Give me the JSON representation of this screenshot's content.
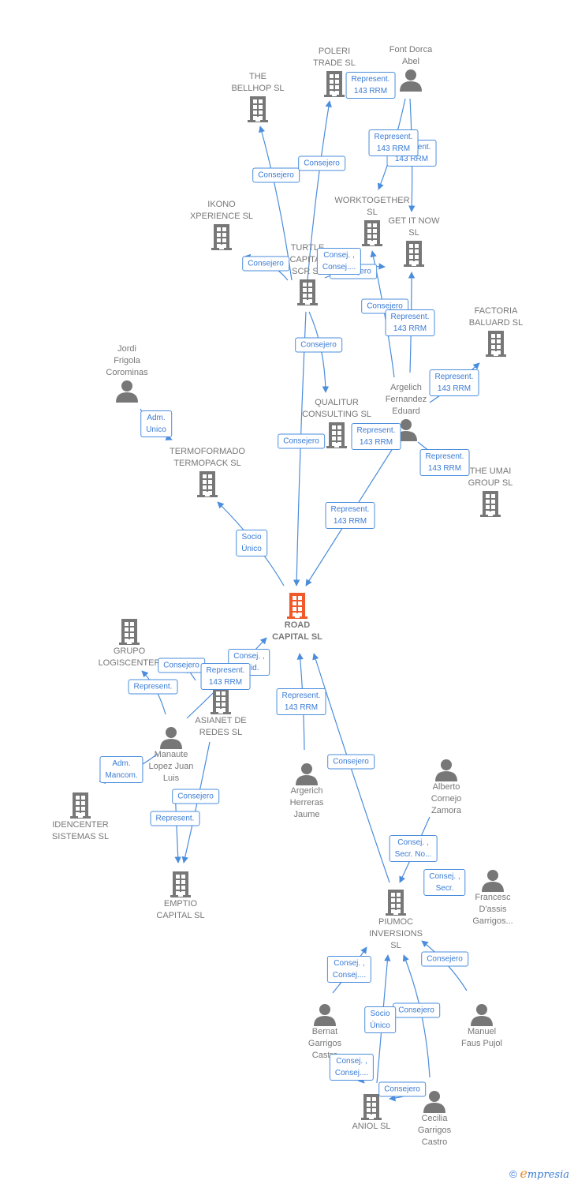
{
  "colors": {
    "company": "#777777",
    "focus": "#f05a28",
    "edge": "#4a8ddc",
    "label_text": "#3a7bd5"
  },
  "nodes": [
    {
      "label": "POLERI\nTRADE  SL",
      "type": "company"
    },
    {
      "label": "Font Dorca\nAbel",
      "type": "person"
    },
    {
      "label": "THE\nBELLHOP  SL",
      "type": "company"
    },
    {
      "label": "IKONO\nXPERIENCE  SL",
      "type": "company"
    },
    {
      "label": "WORKTOGETHER\nSL",
      "type": "company"
    },
    {
      "label": "GET IT NOW\nSL",
      "type": "company"
    },
    {
      "label": "TURTLE\nCAPITAL\nSCR SL",
      "type": "company"
    },
    {
      "label": "FACTORIA\nBALUARD  SL",
      "type": "company"
    },
    {
      "label": "Jordi\nFrigola\nCorominas",
      "type": "person"
    },
    {
      "label": "Argelich\nFernandez\nEduard",
      "type": "person"
    },
    {
      "label": "QUALITUR\nCONSULTING SL",
      "type": "company"
    },
    {
      "label": "TERMOFORMADO\nTERMOPACK SL",
      "type": "company"
    },
    {
      "label": "THE UMAI\nGROUP  SL",
      "type": "company"
    },
    {
      "label": "ROAD\nCAPITAL  SL",
      "type": "focus"
    },
    {
      "label": "GRUPO\nLOGISCENTER",
      "type": "company"
    },
    {
      "label": "ASIANET DE\nREDES SL",
      "type": "company"
    },
    {
      "label": "Manaute\nLopez Juan\nLuis",
      "type": "person"
    },
    {
      "label": "IDENCENTER\nSISTEMAS SL",
      "type": "company"
    },
    {
      "label": "Argerich\nHerreras\nJaume",
      "type": "person"
    },
    {
      "label": "Alberto\nCornejo\nZamora",
      "type": "person"
    },
    {
      "label": "EMPTIO\nCAPITAL  SL",
      "type": "company"
    },
    {
      "label": "Francesc\nD'assis\nGarrigos...",
      "type": "person"
    },
    {
      "label": "PIUMOC\nINVERSIONS\nSL",
      "type": "company"
    },
    {
      "label": "Bernat\nGarrigos\nCastro",
      "type": "person"
    },
    {
      "label": "Manuel\nFaus Pujol",
      "type": "person"
    },
    {
      "label": "ANIOL SL",
      "type": "company"
    },
    {
      "label": "Cecilia\nGarrigos\nCastro",
      "type": "person"
    }
  ],
  "edge_labels": [
    "Represent.\n143 RRM",
    "Represent.\n143 RRM",
    "Represent.\n143 RRM",
    "Consejero",
    "Consejero",
    "Consejero",
    "Consejero",
    "Consej. ,\nConsej....",
    "Consejero",
    "Represent.\n143 RRM",
    "Represent.\n143 RRM",
    "Consejero",
    "Adm.\nUnico",
    "Consejero",
    "Represent.\n143 RRM",
    "Represent.\n143 RRM",
    "Represent.\n143 RRM",
    "Socio\nÚnico",
    "Consej. ,\nSolid.",
    "Consejero",
    "Represent.\n143 RRM",
    "Represent.",
    "Represent.\n143 RRM",
    "Adm.\nMancom.",
    "Consejero",
    "Consejero",
    "Represent.",
    "Consej. ,\nSecr. No...",
    "Consej. ,\nSecr.",
    "Consejero",
    "Consej. ,\nConsej....",
    "Consejero",
    "Socio\nÚnico",
    "Consej. ,\nConsej....",
    "Consejero"
  ],
  "footer": {
    "copyright": "©",
    "brand_initial": "e",
    "brand_rest": "mpresia"
  }
}
